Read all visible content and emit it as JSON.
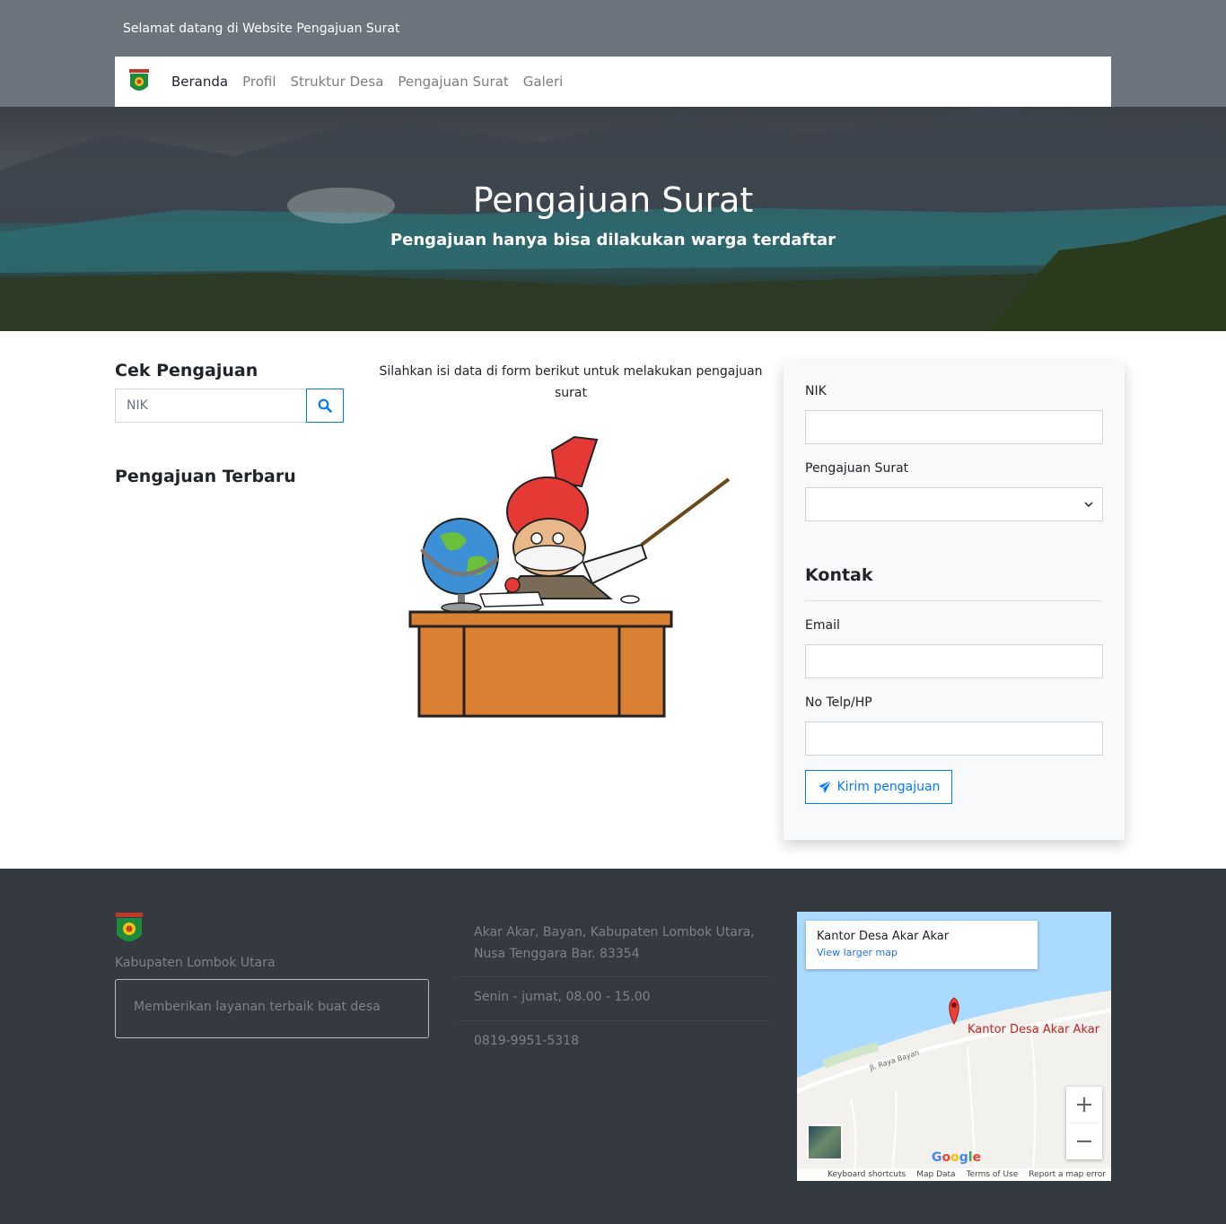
{
  "header": {
    "welcome": "Selamat datang di Website Pengajuan Surat",
    "nav": [
      "Beranda",
      "Profil",
      "Struktur Desa",
      "Pengajuan Surat",
      "Galeri"
    ]
  },
  "hero": {
    "title": "Pengajuan Surat",
    "subtitle": "Pengajuan hanya bisa dilakukan warga terdaftar"
  },
  "sidebar": {
    "cek_title": "Cek Pengajuan",
    "nik_placeholder": "NIK",
    "terbaru_title": "Pengajuan Terbaru"
  },
  "main": {
    "intro": "Silahkan isi data di form berikut untuk melakukan pengajuan surat"
  },
  "form": {
    "nik_label": "NIK",
    "pengajuan_label": "Pengajuan Surat",
    "kontak_title": "Kontak",
    "email_label": "Email",
    "telp_label": "No Telp/HP",
    "submit_label": "Kirim pengajuan"
  },
  "footer": {
    "region": "Kabupaten Lombok Utara",
    "tagline": "Memberikan layanan terbaik buat desa",
    "address": "Akar Akar, Bayan, Kabupaten Lombok Utara, Nusa Tenggara Bar. 83354",
    "hours": "Senin - jumat, 08.00 - 15.00",
    "phone": "0819-9951-5318"
  },
  "map": {
    "place_title": "Kantor Desa Akar Akar",
    "larger_map": "View larger map",
    "pin_label": "Kantor Desa Akar Akar",
    "road_label": "Jl. Raya Bayan",
    "zoom_in": "+",
    "zoom_out": "−",
    "google": "Google",
    "attribution": [
      "Keyboard shortcuts",
      "Map Data",
      "Terms of Use",
      "Report a map error"
    ]
  },
  "colors": {
    "primary": "#007bff",
    "top_band": "#6c757d",
    "footer_bg": "#343a40"
  }
}
